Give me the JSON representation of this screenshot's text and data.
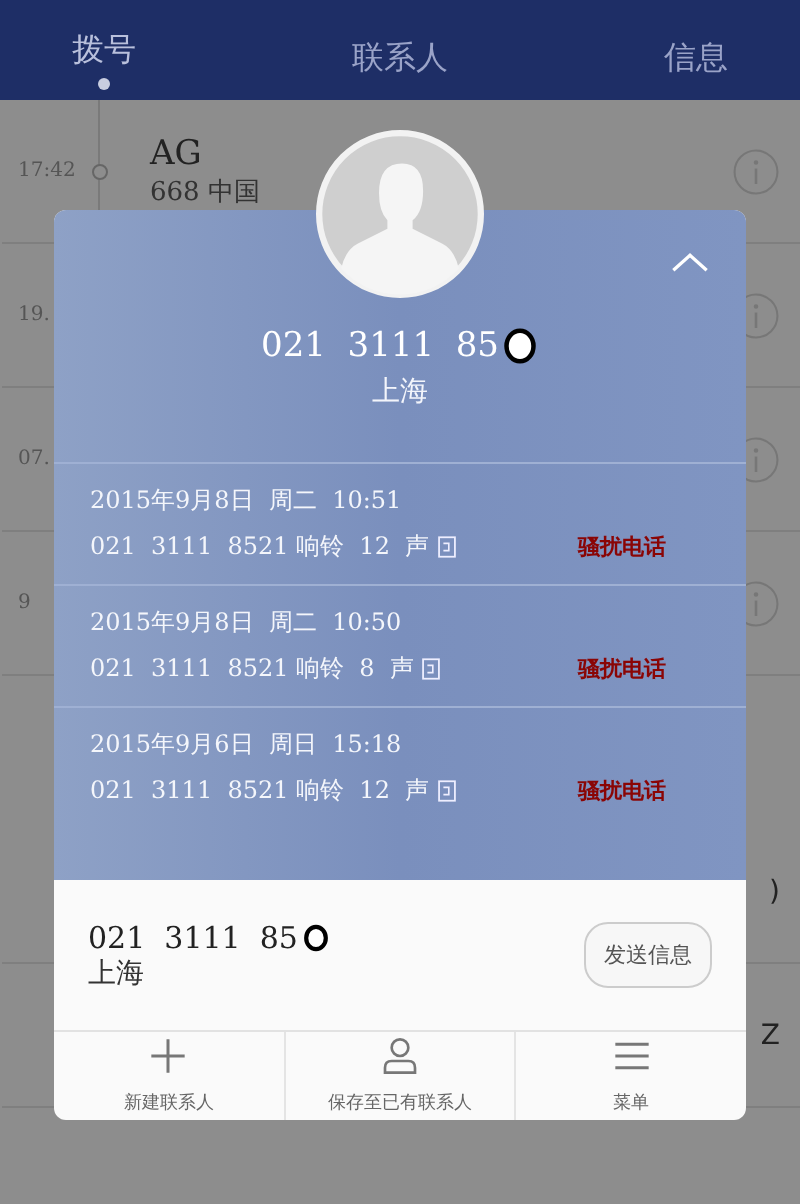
{
  "tabs": [
    {
      "label": "拨号",
      "selected": true
    },
    {
      "label": "联系人",
      "selected": false
    },
    {
      "label": "信息",
      "selected": false
    }
  ],
  "call_log": [
    {
      "time": "17:42",
      "name": "AG",
      "detail": "668  中国"
    },
    {
      "time": "19."
    },
    {
      "time": "07."
    },
    {
      "time": "9"
    },
    {
      "edge": ")"
    },
    {
      "edge": "Z"
    }
  ],
  "card": {
    "number": "021  3111  85",
    "location": "上海",
    "redacted": true,
    "records": [
      {
        "date": "2015年9月8日  周二  10:51",
        "detail": "021  3111  8521 响铃  12  声",
        "tag": "骚扰电话"
      },
      {
        "date": "2015年9月8日  周二  10:50",
        "detail": "021  3111  8521 响铃  8  声",
        "tag": "骚扰电话"
      },
      {
        "date": "2015年9月6日  周日  15:18",
        "detail": "021  3111  8521 响铃  12  声",
        "tag": "骚扰电话"
      }
    ],
    "footer_number": "021  3111  85",
    "footer_location": "上海",
    "send_button": "发送信息",
    "actions": [
      {
        "kind": "add",
        "label": "新建联系人"
      },
      {
        "kind": "person",
        "label": "保存至已有联系人"
      },
      {
        "kind": "menu",
        "label": "菜单"
      }
    ]
  }
}
